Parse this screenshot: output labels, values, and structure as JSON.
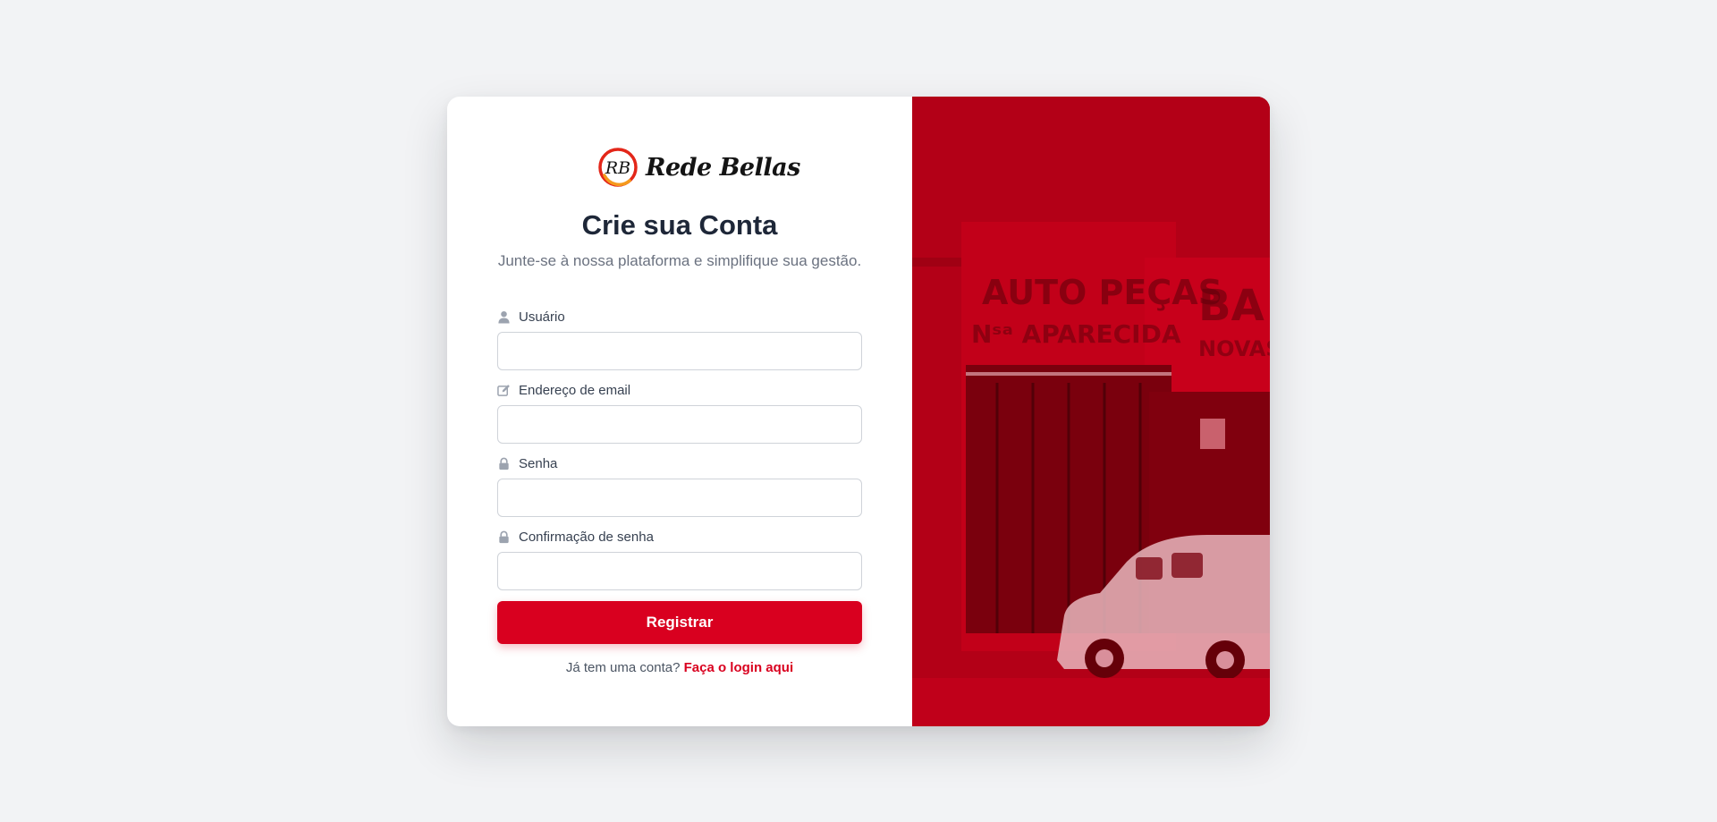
{
  "brand": {
    "name": "Rede Bellas",
    "logo_monogram": "RB",
    "logo_icon": "rb-logo-icon",
    "accent_color": "#d9001f"
  },
  "header": {
    "title": "Crie sua Conta",
    "subtitle": "Junte-se à nossa plataforma e simplifique sua gestão."
  },
  "form": {
    "fields": [
      {
        "label": "Usuário",
        "icon": "user-icon",
        "value": ""
      },
      {
        "label": "Endereço de email",
        "icon": "edit-icon",
        "value": ""
      },
      {
        "label": "Senha",
        "icon": "lock-icon",
        "value": ""
      },
      {
        "label": "Confirmação de senha",
        "icon": "lock-icon",
        "value": ""
      }
    ],
    "submit_label": "Registrar"
  },
  "footer": {
    "prompt": "Já tem uma conta?",
    "link_label": "Faça o login aqui"
  },
  "side_image": {
    "sign_text": "AUTO PEÇAS",
    "sign_subtext": "Nˢᵃ APARECIDA",
    "sign_text_right": "BA",
    "sign_subtext_right": "NOVAS",
    "tint_color": "#c0001a"
  }
}
